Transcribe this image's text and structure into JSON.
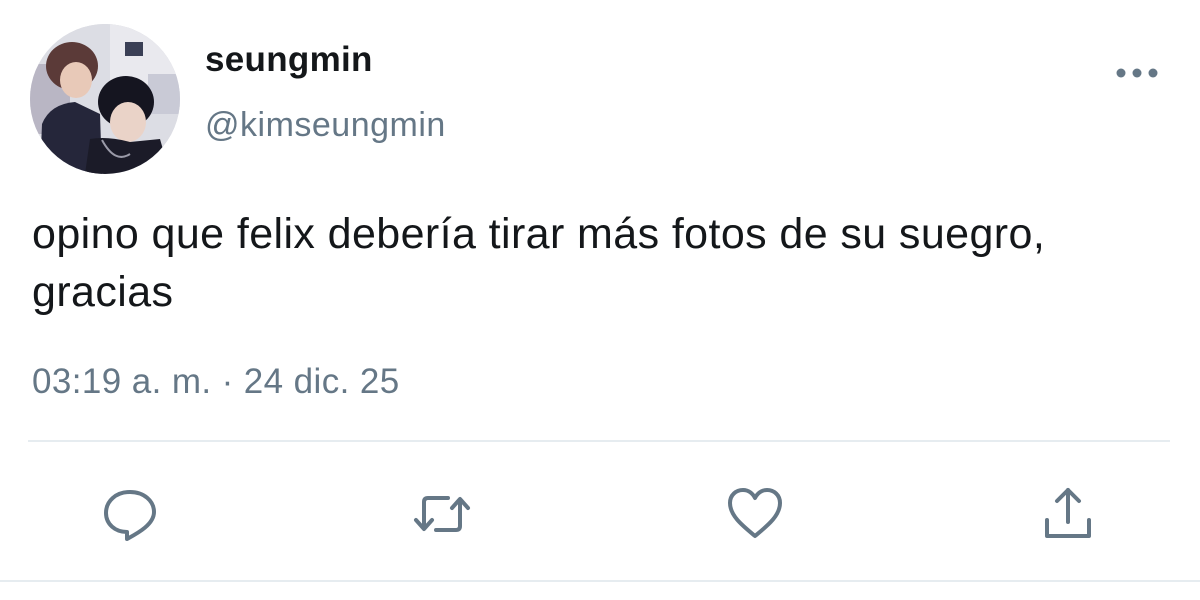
{
  "tweet": {
    "display_name": "seungmin",
    "handle": "@kimseungmin",
    "text": "opino que felix debería tirar más fotos de su suegro, gracias",
    "timestamp": "03:19 a. m. · 24 dic. 25"
  },
  "icons": {
    "more": "more-horizontal-icon",
    "reply": "reply-icon",
    "retweet": "retweet-icon",
    "like": "heart-icon",
    "share": "share-icon"
  },
  "colors": {
    "text_primary": "#14171a",
    "text_secondary": "#657786",
    "icon": "#657786",
    "divider": "#e6ecf0"
  }
}
